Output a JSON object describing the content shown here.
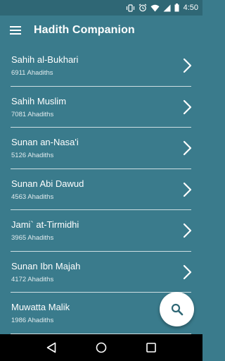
{
  "status_bar": {
    "time": "4:50",
    "icons": [
      "vibrate-icon",
      "alarm-icon",
      "wifi-icon",
      "cell-signal-icon",
      "battery-icon"
    ]
  },
  "app_bar": {
    "title": "Hadith Companion",
    "menu_icon": "menu-icon"
  },
  "collections": [
    {
      "title": "Sahih al-Bukhari",
      "count": "6911 Ahadiths"
    },
    {
      "title": "Sahih Muslim",
      "count": "7081 Ahadiths"
    },
    {
      "title": "Sunan an-Nasa'i",
      "count": "5126 Ahadiths"
    },
    {
      "title": "Sunan Abi Dawud",
      "count": "4563 Ahadiths"
    },
    {
      "title": "Jami` at-Tirmidhi",
      "count": "3965 Ahadiths"
    },
    {
      "title": "Sunan Ibn Majah",
      "count": "4172 Ahadiths"
    },
    {
      "title": "Muwatta Malik",
      "count": "1986 Ahadiths"
    }
  ],
  "fab": {
    "icon": "search-icon"
  },
  "colors": {
    "background": "#3a7b8c",
    "status_bar": "#2f6775",
    "fab_icon": "#2f6775"
  }
}
